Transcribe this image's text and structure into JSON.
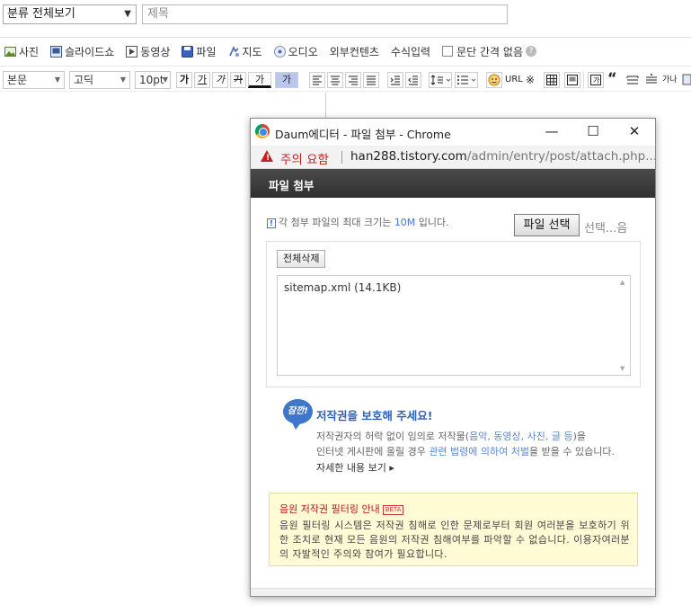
{
  "editor": {
    "category_select": "분류 전체보기",
    "title_placeholder": "제목",
    "media_toolbar": {
      "photo": "사진",
      "slideshow": "슬라이드쇼",
      "video": "동영상",
      "file": "파일",
      "map": "지도",
      "audio": "오디오",
      "external": "외부컨텐츠",
      "formula": "수식입력",
      "no_paragraph_spacing": "문단 간격 없음"
    },
    "format_toolbar": {
      "paragraph_style": "본문",
      "font": "고딕",
      "font_size": "10pt",
      "bold": "가",
      "underline": "가",
      "italic": "가",
      "strike": "가",
      "fontcolor": "가",
      "bgcolor": "가",
      "url": "URL",
      "special_char": "※",
      "quote": "“",
      "char_spacing": "가나"
    }
  },
  "popup": {
    "window_title": "Daum에디터 - 파일 첨부 - Chrome",
    "warning_label": "주의 요함",
    "url_host": "han288.tistory.com",
    "url_path": "/admin/entry/post/attach.php...",
    "header_title": "파일 첨부",
    "info_prefix": "각 첨부 파일의 최대 크기는 ",
    "info_size": "10M",
    "info_suffix": " 입니다.",
    "choose_file_button": "파일 선택",
    "choose_file_status": "선택...음",
    "delete_all_button": "전체삭제",
    "files": [
      "sitemap.xml (14.1KB)"
    ],
    "copyright_badge": "잠깐!",
    "copyright_title": "저작권을 보호해 주세요!",
    "copyright_line1_a": "저작권자의 허락 없이 임의로 저작물(",
    "copyright_line1_b": "음악, 동영상, 사진, 글 등",
    "copyright_line1_c": ")을",
    "copyright_line2_a": "인터넷 게시판에 올릴 경우 ",
    "copyright_line2_b": "관련 법령에 의하여 처벌",
    "copyright_line2_c": "을 받을 수 있습니다.",
    "more_link": "자세한 내용 보기 ▸",
    "notice_title": "음원 저작권 필터링 안내",
    "notice_beta": "BETA",
    "notice_body": "음원 필터링 시스템은 저작권 침해로 인한 문제로부터 회원 여러분을 보호하기 위한 조치로 현재 모든 음원의 저작권 침해여부를 파악할 수 없습니다. 이용자여러분의 자발적인 주의와 참여가 필요합니다."
  },
  "colors": {
    "warning_red": "#c5221f",
    "header_dark": "#3a3a3a",
    "link_blue": "#2e62b8",
    "notice_bg": "#fffbd5"
  }
}
